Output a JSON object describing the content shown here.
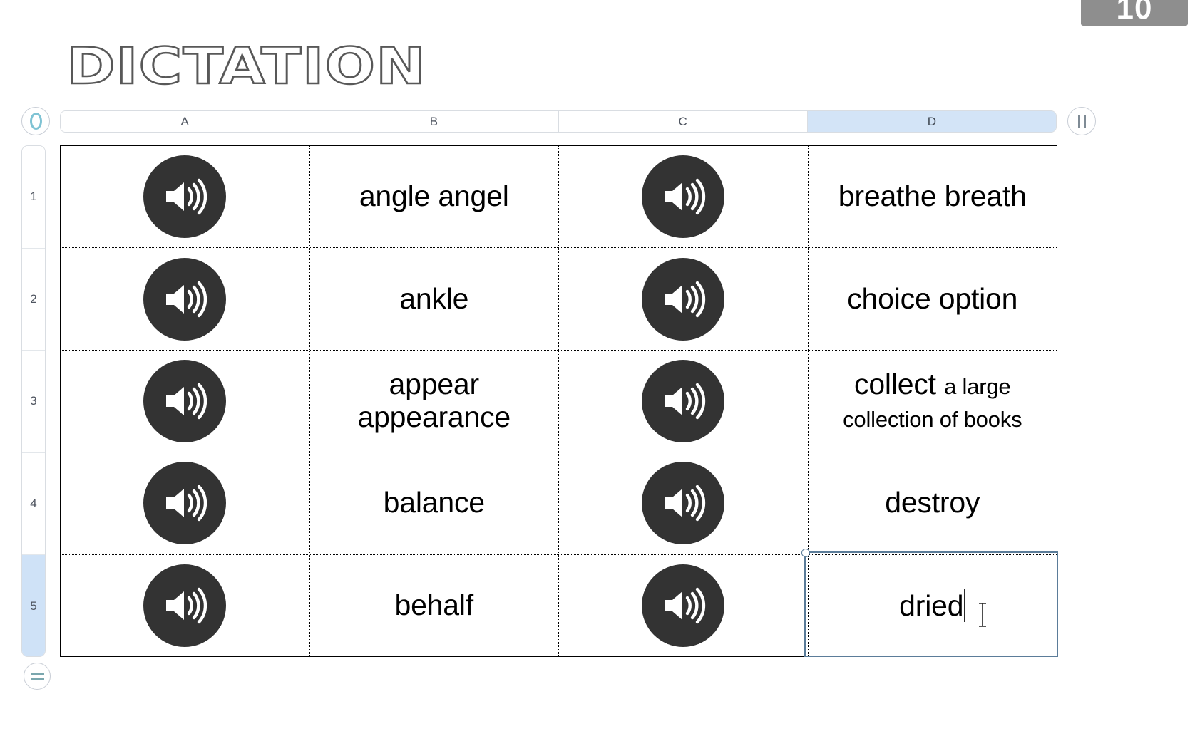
{
  "page": {
    "title": "DICTATION",
    "top_badge_label": "10",
    "background_color": "#ffffff",
    "accent_color": "#d3e4f7",
    "selection_border_color": "#5b7c99",
    "speaker_button_color": "#333333"
  },
  "controls": {
    "left_circle": {
      "name": "record-ring",
      "icon": "ring-icon"
    },
    "right_circle": {
      "name": "pause",
      "icon": "pause-icon"
    },
    "bottom_circle": {
      "name": "rows-menu",
      "icon": "equals-icon"
    }
  },
  "columns": [
    {
      "label": "A",
      "selected": false
    },
    {
      "label": "B",
      "selected": false
    },
    {
      "label": "C",
      "selected": false
    },
    {
      "label": "D",
      "selected": true
    }
  ],
  "rows": [
    {
      "label": "1",
      "selected": false
    },
    {
      "label": "2",
      "selected": false
    },
    {
      "label": "3",
      "selected": false
    },
    {
      "label": "4",
      "selected": false
    },
    {
      "label": "5",
      "selected": true
    }
  ],
  "grid": {
    "rows": [
      {
        "a": {
          "type": "audio",
          "icon": "speaker-icon"
        },
        "b": {
          "type": "text",
          "main": "angle angel",
          "detail": ""
        },
        "c": {
          "type": "audio",
          "icon": "speaker-icon"
        },
        "d": {
          "type": "text",
          "main": "breathe breath",
          "detail": ""
        }
      },
      {
        "a": {
          "type": "audio",
          "icon": "speaker-icon"
        },
        "b": {
          "type": "text",
          "main": "ankle",
          "detail": ""
        },
        "c": {
          "type": "audio",
          "icon": "speaker-icon"
        },
        "d": {
          "type": "text",
          "main": "choice option",
          "detail": ""
        }
      },
      {
        "a": {
          "type": "audio",
          "icon": "speaker-icon"
        },
        "b": {
          "type": "text",
          "main": "appear appearance",
          "detail": ""
        },
        "c": {
          "type": "audio",
          "icon": "speaker-icon"
        },
        "d": {
          "type": "text",
          "main": "collect",
          "detail": "a large collection of books"
        }
      },
      {
        "a": {
          "type": "audio",
          "icon": "speaker-icon"
        },
        "b": {
          "type": "text",
          "main": "balance",
          "detail": ""
        },
        "c": {
          "type": "audio",
          "icon": "speaker-icon"
        },
        "d": {
          "type": "text",
          "main": "destroy",
          "detail": ""
        }
      },
      {
        "a": {
          "type": "audio",
          "icon": "speaker-icon"
        },
        "b": {
          "type": "text",
          "main": "behalf",
          "detail": ""
        },
        "c": {
          "type": "audio",
          "icon": "speaker-icon"
        },
        "d": {
          "type": "text",
          "main": "dried",
          "detail": ""
        }
      }
    ]
  },
  "selection": {
    "cell": "D5",
    "editing_value": "dried",
    "caret_visible": true,
    "cursor": "i-beam"
  }
}
